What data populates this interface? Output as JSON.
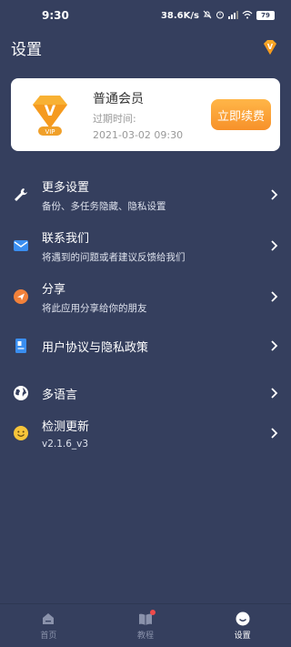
{
  "status_bar": {
    "time": "9:30",
    "network_speed": "38.6K/s",
    "battery": "79"
  },
  "header": {
    "title": "设置",
    "vip_icon": "vip-diamond-icon"
  },
  "vip_card": {
    "badge_letter": "V",
    "badge_text": "VIP",
    "level": "普通会员",
    "expire_label": "过期时间:",
    "expire_date": "2021-03-02 09:30",
    "renew_label": "立即续费"
  },
  "menu": {
    "items": [
      {
        "title": "更多设置",
        "subtitle": "备份、多任务隐藏、隐私设置",
        "icon": "wrench-icon"
      },
      {
        "title": "联系我们",
        "subtitle": "将遇到的问题或者建议反馈给我们",
        "icon": "mail-icon"
      },
      {
        "title": "分享",
        "subtitle": "将此应用分享给你的朋友",
        "icon": "share-icon"
      },
      {
        "title": "用户协议与隐私政策",
        "subtitle": "",
        "icon": "document-icon"
      },
      {
        "title": "多语言",
        "subtitle": "",
        "icon": "globe-icon"
      },
      {
        "title": "检测更新",
        "subtitle": "v2.1.6_v3",
        "icon": "smiley-icon"
      }
    ]
  },
  "tabbar": {
    "tabs": [
      {
        "label": "首页",
        "icon": "home-icon"
      },
      {
        "label": "教程",
        "icon": "book-icon"
      },
      {
        "label": "设置",
        "icon": "settings-face-icon"
      }
    ]
  },
  "colors": {
    "background": "#353f5e",
    "accent_orange": "#f7912a",
    "card": "#ffffff"
  }
}
